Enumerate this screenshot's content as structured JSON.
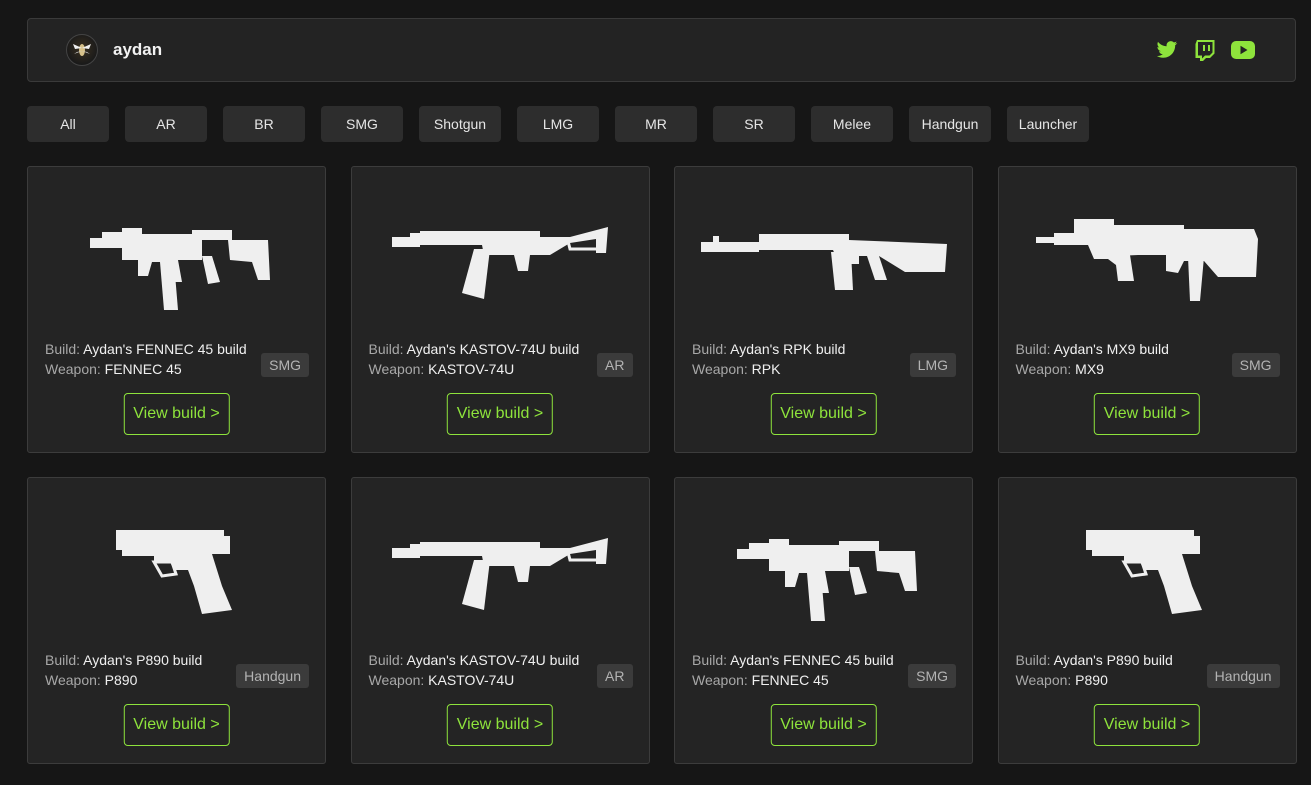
{
  "header": {
    "username": "aydan",
    "avatar_icon": "wasp-logo-icon",
    "accent": "#8ee33c",
    "socials": [
      {
        "name": "twitter-icon"
      },
      {
        "name": "twitch-icon"
      },
      {
        "name": "youtube-icon"
      }
    ]
  },
  "filters": [
    "All",
    "AR",
    "BR",
    "SMG",
    "Shotgun",
    "LMG",
    "MR",
    "SR",
    "Melee",
    "Handgun",
    "Launcher"
  ],
  "card_labels": {
    "build": "Build:",
    "weapon": "Weapon:",
    "view": "View build >"
  },
  "cards": [
    {
      "build": "Aydan's FENNEC 45 build",
      "weapon": "FENNEC 45",
      "category": "SMG",
      "icon": "smg-fennec-icon"
    },
    {
      "build": "Aydan's KASTOV-74U build",
      "weapon": "KASTOV-74U",
      "category": "AR",
      "icon": "rifle-kastov-icon"
    },
    {
      "build": "Aydan's RPK build",
      "weapon": "RPK",
      "category": "LMG",
      "icon": "lmg-rpk-icon"
    },
    {
      "build": "Aydan's MX9 build",
      "weapon": "MX9",
      "category": "SMG",
      "icon": "smg-mx9-icon"
    },
    {
      "build": "Aydan's P890 build",
      "weapon": "P890",
      "category": "Handgun",
      "icon": "pistol-p890-icon"
    },
    {
      "build": "Aydan's KASTOV-74U build",
      "weapon": "KASTOV-74U",
      "category": "AR",
      "icon": "rifle-kastov-icon"
    },
    {
      "build": "Aydan's FENNEC 45 build",
      "weapon": "FENNEC 45",
      "category": "SMG",
      "icon": "smg-fennec-icon"
    },
    {
      "build": "Aydan's P890 build",
      "weapon": "P890",
      "category": "Handgun",
      "icon": "pistol-p890-icon"
    }
  ]
}
